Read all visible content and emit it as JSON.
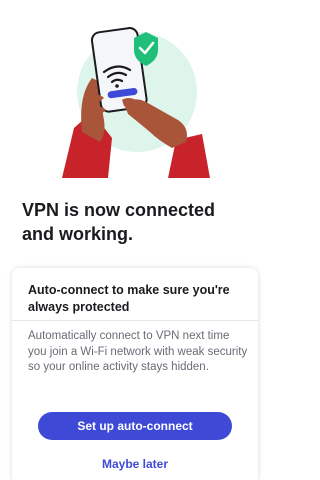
{
  "headline": "VPN is now connected and working.",
  "card": {
    "title": "Auto-connect to make sure you're always protected",
    "body": "Automatically connect to VPN next time you join a Wi-Fi network with weak security so your online activity stays hidden.",
    "primary_label": "Set up auto-connect",
    "secondary_label": "Maybe later"
  },
  "colors": {
    "accent": "#3e4ad6",
    "check_green": "#1fbf7a",
    "circle_mint": "#ddf5ea",
    "sleeve_red": "#c8232b",
    "skin": "#a9553a",
    "text_dark": "#1b1b1f",
    "text_muted": "#6b6b76"
  },
  "icons": [
    "phone-wifi-illustration",
    "wifi-icon",
    "check-shield-icon"
  ]
}
